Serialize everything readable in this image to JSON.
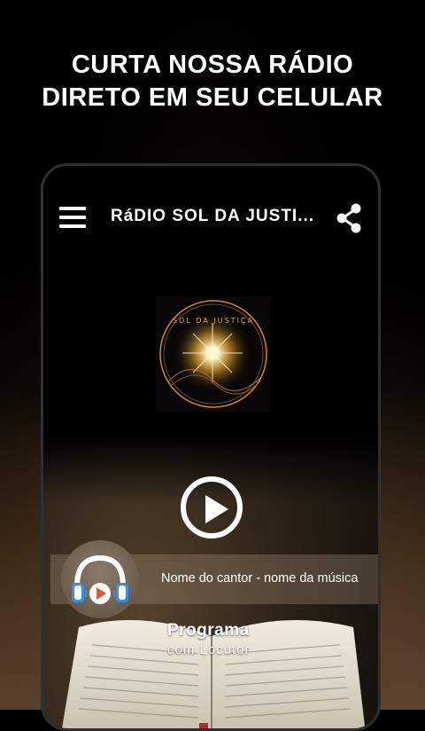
{
  "promo": {
    "line1": "CURTA NOSSA RÁDIO",
    "line2": "DIRETO EM SEU CELULAR"
  },
  "app_bar": {
    "title": "RáDIO SOL DA JUSTI...",
    "menu_icon": "hamburger-menu-icon",
    "share_icon": "share-icon"
  },
  "logo": {
    "text": "SOL DA JUSTIÇA"
  },
  "player": {
    "play_icon": "play-icon",
    "now_playing": "Nome do cantor - nome da música",
    "avatar_icon": "headphones-play-icon"
  },
  "program": {
    "name": "Programa",
    "host": "com Locutor"
  },
  "colors": {
    "accent_blue": "#3a8fd9",
    "accent_orange": "#e8542a",
    "text": "#ffffff"
  }
}
